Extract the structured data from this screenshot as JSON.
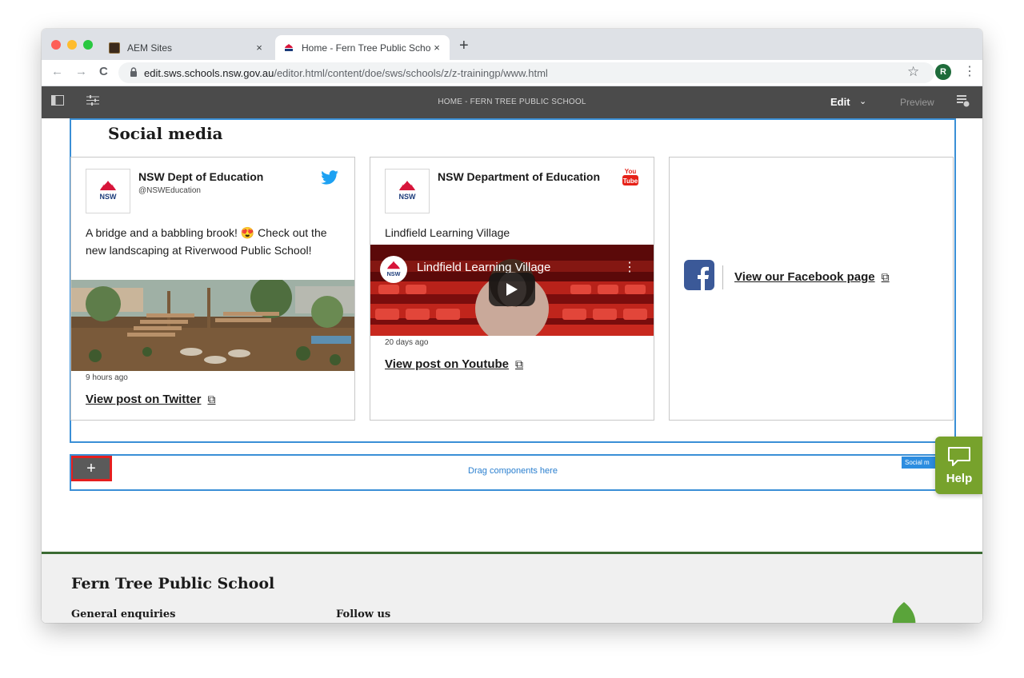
{
  "browser": {
    "tabs": [
      {
        "title": "AEM Sites",
        "close": "×"
      },
      {
        "title": "Home - Fern Tree Public School",
        "close": "×"
      }
    ],
    "new_tab": "+",
    "nav": {
      "back": "←",
      "forward": "→",
      "reload": "C"
    },
    "url_host": "edit.sws.schools.nsw.gov.au",
    "url_path": "/editor.html/content/doe/sws/schools/z/z-trainingp/www.html",
    "star": "☆",
    "avatar_letter": "R",
    "menu": "⋮"
  },
  "aem": {
    "page_title": "HOME - FERN TREE PUBLIC SCHOOL",
    "edit_label": "Edit",
    "edit_chevron": "⌄",
    "preview_label": "Preview"
  },
  "social": {
    "title": "Social media",
    "twitter": {
      "name": "NSW Dept of Education",
      "handle": "@NSWEducation",
      "text": "A bridge and a babbling brook! 😍  Check out the new landscaping at Riverwood Public School!",
      "time": "9 hours ago",
      "link": "View post on Twitter"
    },
    "youtube": {
      "name": "NSW Department of Education",
      "video_caption": "Lindfield Learning Village",
      "video_title": "Lindfield Learning Village",
      "time": "20 days ago",
      "link": "View post on Youtube"
    },
    "facebook": {
      "link": "View our Facebook page"
    },
    "logo_text": "NSW",
    "youtube_logo_text": [
      "You",
      "Tube"
    ],
    "ext_icon": "⧉"
  },
  "editor": {
    "add_label": "+",
    "component_badge": "Social m",
    "drag_text": "Drag components here",
    "help_label": "Help"
  },
  "footer": {
    "school_name": "Fern Tree Public School",
    "col1": "General enquiries",
    "col2": "Follow us"
  },
  "colors": {
    "aem_bar": "#4b4b4b",
    "outline_blue": "#3a8fd6",
    "highlight_red": "#e51e1e",
    "help_green": "#77a22c",
    "footer_rule": "#3b6b33",
    "twitter": "#1da1f2",
    "youtube": "#e62117",
    "facebook": "#3b5998"
  }
}
